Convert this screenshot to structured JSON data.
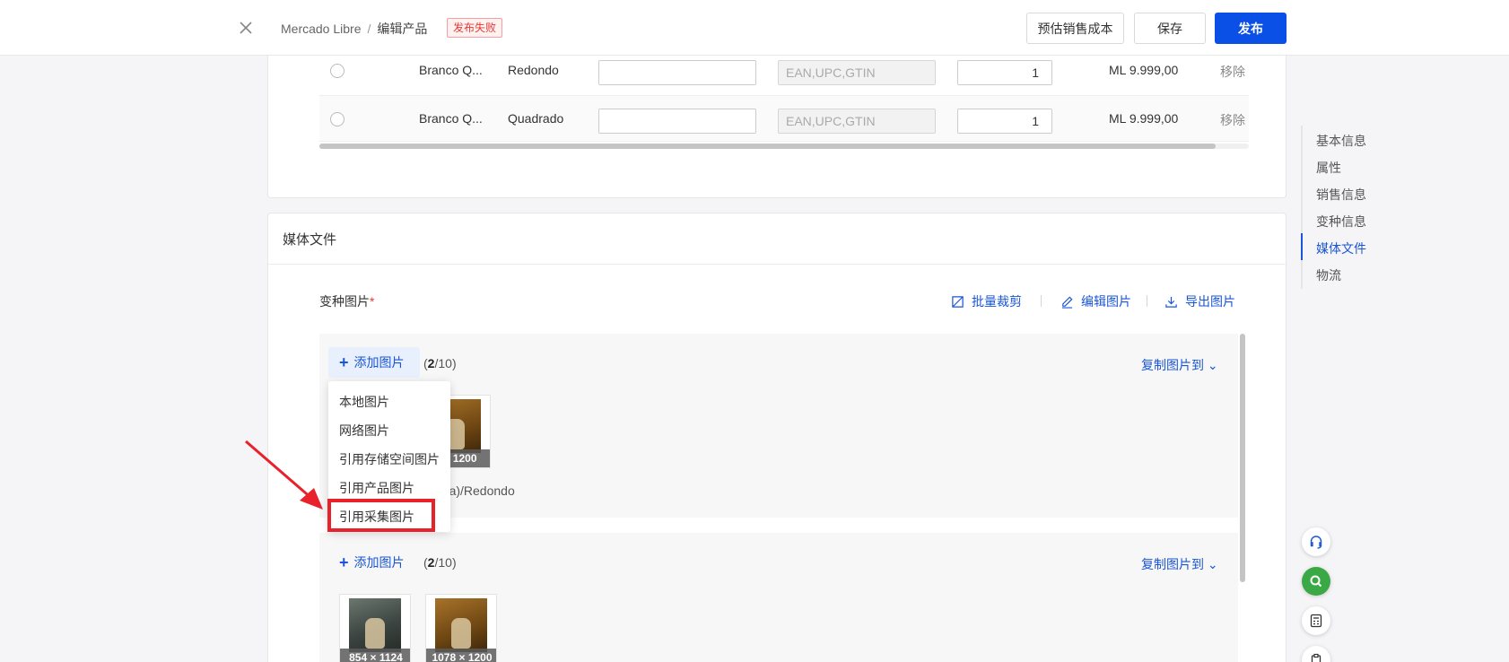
{
  "header": {
    "breadcrumb_root": "Mercado Libre",
    "breadcrumb_sep": "/",
    "breadcrumb_current": "编辑产品",
    "status_badge": "发布失败",
    "estimate_label": "预估销售成本",
    "save_label": "保存",
    "publish_label": "发布"
  },
  "variants_table": {
    "rows": [
      {
        "name": "Branco Q...",
        "shape": "Redondo",
        "sku": "",
        "ean_placeholder": "EAN,UPC,GTIN",
        "qty": "1",
        "price": "ML 9.999,00",
        "remove": "移除"
      },
      {
        "name": "Branco Q...",
        "shape": "Quadrado",
        "sku": "",
        "ean_placeholder": "EAN,UPC,GTIN",
        "qty": "1",
        "price": "ML 9.999,00",
        "remove": "移除"
      }
    ]
  },
  "media": {
    "title": "媒体文件",
    "variant_images_label": "变种图片",
    "required_mark": "*",
    "tools": {
      "crop": "批量裁剪",
      "edit": "编辑图片",
      "export": "导出图片"
    },
    "blocks": [
      {
        "add_label": "添加图片",
        "count_current": "2",
        "count_max": "10",
        "copy_label": "复制图片到",
        "images": [
          {
            "dims": "1078 × 1200",
            "shown_dims": "3 × 1200"
          }
        ],
        "variant_name_visible": "anca)/Redondo"
      },
      {
        "add_label": "添加图片",
        "count_current": "2",
        "count_max": "10",
        "copy_label": "复制图片到",
        "images": [
          {
            "dims": "854 × 1124"
          },
          {
            "dims": "1078 × 1200"
          }
        ]
      }
    ],
    "add_menu": [
      "本地图片",
      "网络图片",
      "引用存储空间图片",
      "引用产品图片",
      "引用采集图片"
    ],
    "highlight_color": "#e8212b"
  },
  "anchor_nav": {
    "items": [
      "基本信息",
      "属性",
      "销售信息",
      "变种信息",
      "媒体文件",
      "物流"
    ],
    "active": "媒体文件"
  },
  "colors": {
    "primary": "#0a50e6",
    "link": "#1a56d6",
    "error": "#e53935",
    "fab_green": "#3aa845"
  },
  "icons": [
    "close-icon",
    "crop-icon",
    "edit-icon",
    "download-icon",
    "plus-icon",
    "chevron-down-icon",
    "headset-icon",
    "search-icon",
    "calculator-icon",
    "clipboard-icon",
    "arrow-annotation"
  ]
}
